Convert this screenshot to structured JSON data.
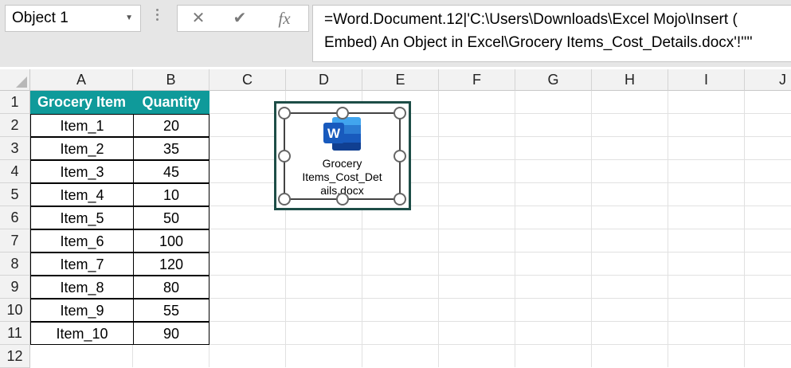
{
  "name_box": {
    "value": "Object 1"
  },
  "formula_bar": {
    "cancel_icon": "close-icon",
    "enter_icon": "check-icon",
    "fx_label": "fx",
    "formula_line1": "=Word.Document.12|'C:\\Users\\Downloads\\Excel Mojo\\Insert (",
    "formula_line2": "Embed) An Object in Excel\\Grocery Items_Cost_Details.docx'!''''"
  },
  "columns": [
    "A",
    "B",
    "C",
    "D",
    "E",
    "F",
    "G",
    "H",
    "I",
    "J"
  ],
  "rows": [
    "1",
    "2",
    "3",
    "4",
    "5",
    "6",
    "7",
    "8",
    "9",
    "10",
    "11",
    "12"
  ],
  "table": {
    "headers": [
      "Grocery Item",
      "Quantity"
    ],
    "header_color": "#0f9a9a",
    "rows": [
      [
        "Item_1",
        "20"
      ],
      [
        "Item_2",
        "35"
      ],
      [
        "Item_3",
        "45"
      ],
      [
        "Item_4",
        "10"
      ],
      [
        "Item_5",
        "50"
      ],
      [
        "Item_6",
        "100"
      ],
      [
        "Item_7",
        "120"
      ],
      [
        "Item_8",
        "80"
      ],
      [
        "Item_9",
        "55"
      ],
      [
        "Item_10",
        "90"
      ]
    ]
  },
  "embedded_object": {
    "icon": "word-document-icon",
    "icon_letter": "W",
    "label_line1": "Grocery",
    "label_line2": "Items_Cost_Det",
    "label_line3": "ails.docx"
  }
}
